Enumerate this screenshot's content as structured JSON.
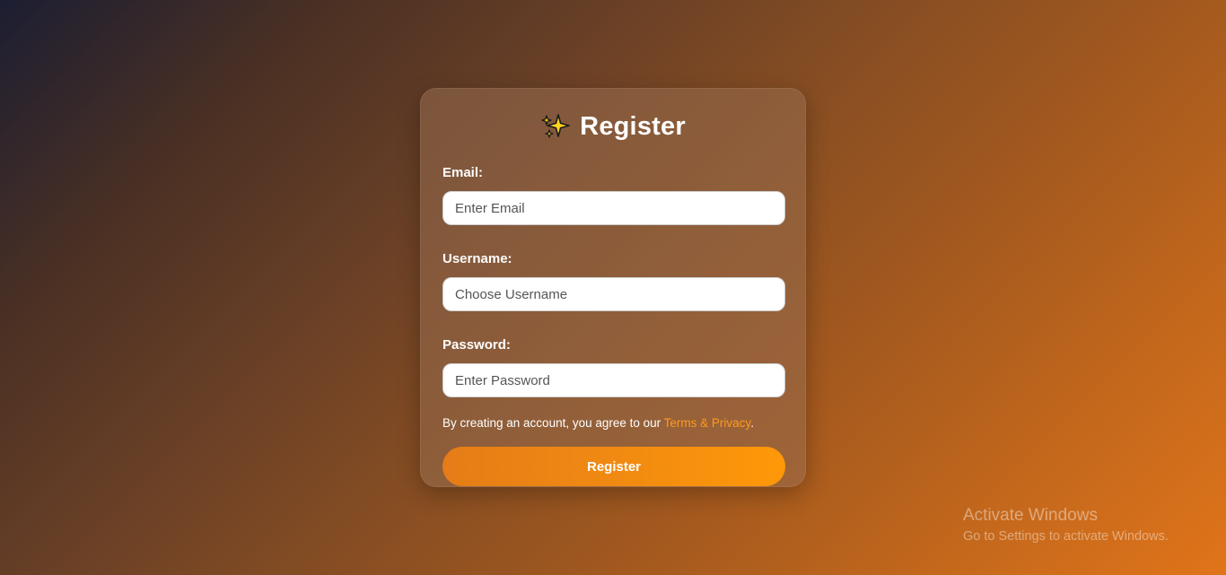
{
  "form": {
    "title": "Register",
    "title_icon": "sparkles-icon",
    "fields": [
      {
        "label": "Email:",
        "placeholder": "Enter Email",
        "value": ""
      },
      {
        "label": "Username:",
        "placeholder": "Choose Username",
        "value": ""
      },
      {
        "label": "Password:",
        "placeholder": "Enter Password",
        "value": ""
      }
    ],
    "terms_prefix": "By creating an account, you agree to our ",
    "terms_link": "Terms & Privacy",
    "terms_suffix": ".",
    "submit_label": "Register"
  },
  "watermark": {
    "title": "Activate Windows",
    "subtitle": "Go to Settings to activate Windows."
  },
  "colors": {
    "accent": "#ff9a1f",
    "button_start": "#e57c17",
    "button_end": "#ff9808",
    "background_start": "#1c1e32",
    "background_end": "#e0741a"
  }
}
